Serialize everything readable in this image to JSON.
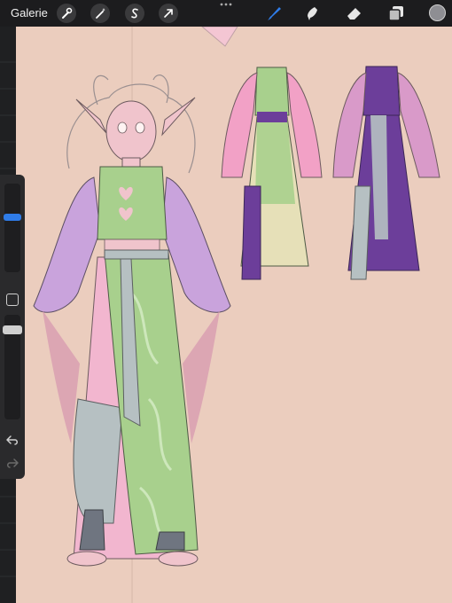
{
  "topbar": {
    "gallery_label": "Galerie"
  },
  "colors": {
    "canvas_bg": "#ebcdbe",
    "toolbar_bg": "#1c1c1e",
    "accent_brush": "#2f7ce8",
    "current_color": "#8e8e93",
    "skin_pink": "#f0c4cc",
    "sleeve_lavender": "#c9a3dc",
    "outfit_green": "#a8d08d",
    "gray_pants": "#b6c0c2",
    "purple": "#6c3e9a",
    "pink_sleeve": "#f2a1c6"
  },
  "icons": {
    "settings": "wrench-icon",
    "adjustments": "magic-wand-icon",
    "selection": "selection-s-icon",
    "transform": "arrow-cursor-icon",
    "more": "ellipsis-icon",
    "brush": "brush-icon",
    "smudge": "smudge-icon",
    "eraser": "eraser-icon",
    "layers": "layers-icon",
    "color": "color-circle-icon",
    "modify": "square-modify-icon",
    "undo": "undo-icon",
    "redo": "redo-icon"
  }
}
